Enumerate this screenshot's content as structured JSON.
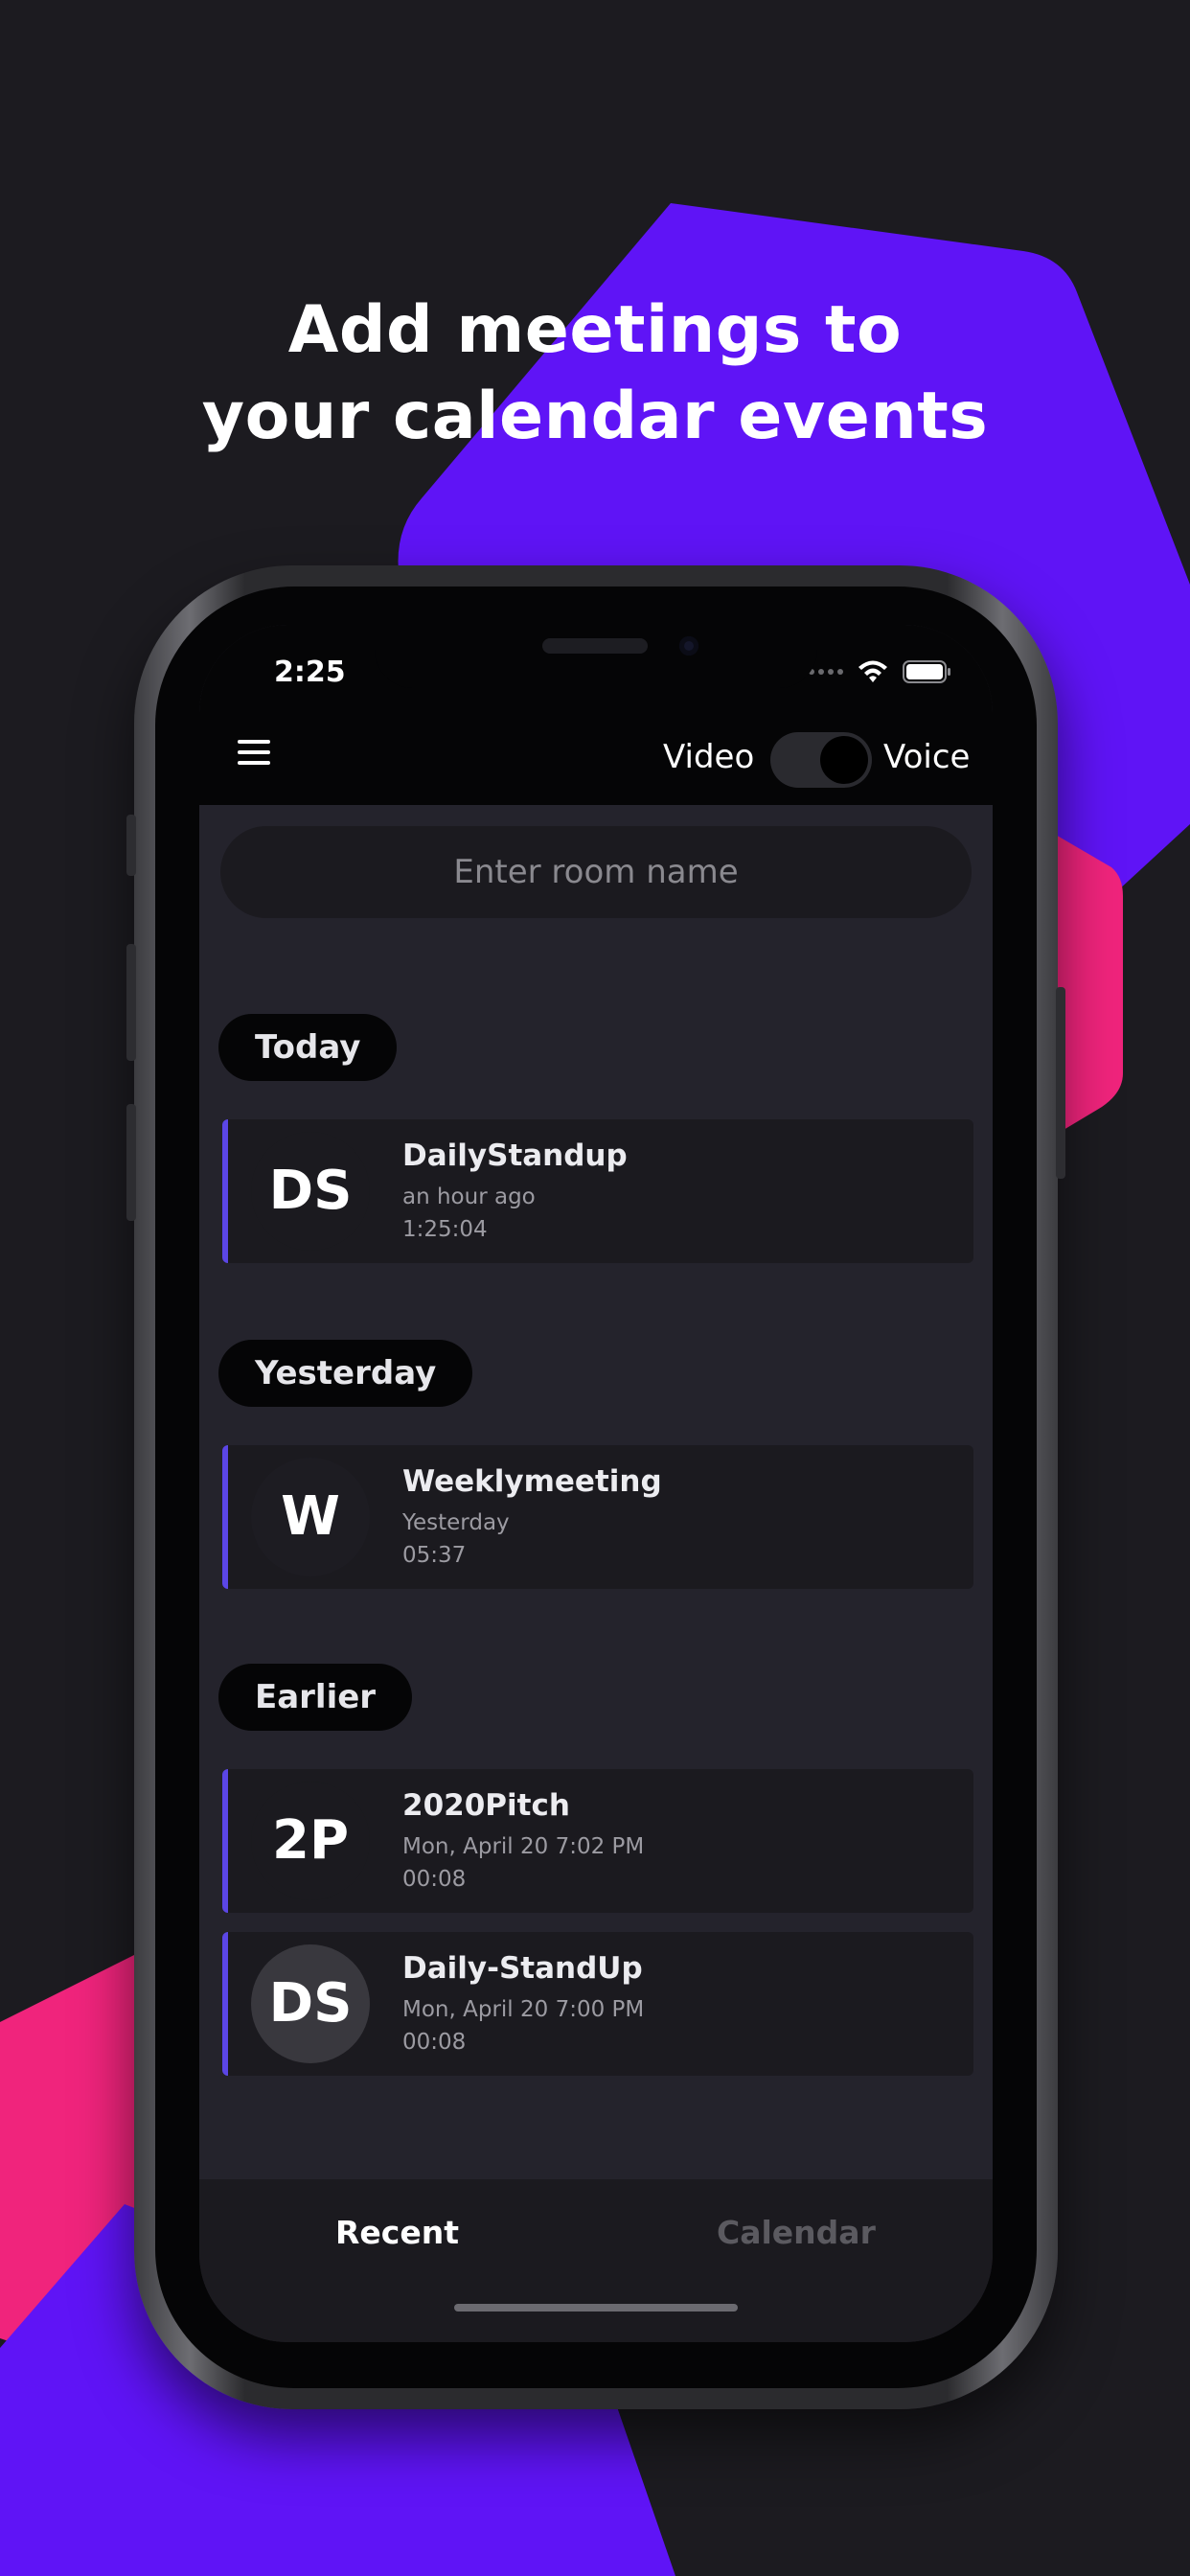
{
  "headline": {
    "line1": "Add meetings to",
    "line2": "your calendar events"
  },
  "colors": {
    "background": "#1c1b20",
    "purple": "#5f14f6",
    "pink": "#f0247c",
    "accent": "#5b46e6"
  },
  "status_bar": {
    "time": "2:25",
    "icons": [
      "cellular-signal-icon",
      "wifi-icon",
      "battery-icon"
    ]
  },
  "app_bar": {
    "menu_icon": "hamburger-menu-icon",
    "mode_left": "Video",
    "mode_right": "Voice",
    "toggle_state": "Voice"
  },
  "search": {
    "placeholder": "Enter room name"
  },
  "sections": {
    "today": "Today",
    "yesterday": "Yesterday",
    "earlier": "Earlier"
  },
  "meetings": [
    {
      "initials": "DS",
      "name": "DailyStandup",
      "when": "an hour ago",
      "duration": "1:25:04"
    },
    {
      "initials": "W",
      "name": "Weeklymeeting",
      "when": "Yesterday",
      "duration": "05:37"
    },
    {
      "initials": "2P",
      "name": "2020Pitch",
      "when": "Mon, April 20 7:02 PM",
      "duration": "00:08"
    },
    {
      "initials": "DS",
      "name": "Daily-StandUp",
      "when": "Mon, April 20 7:00 PM",
      "duration": "00:08"
    }
  ],
  "tabs": {
    "recent": "Recent",
    "calendar": "Calendar",
    "active": "Recent"
  }
}
